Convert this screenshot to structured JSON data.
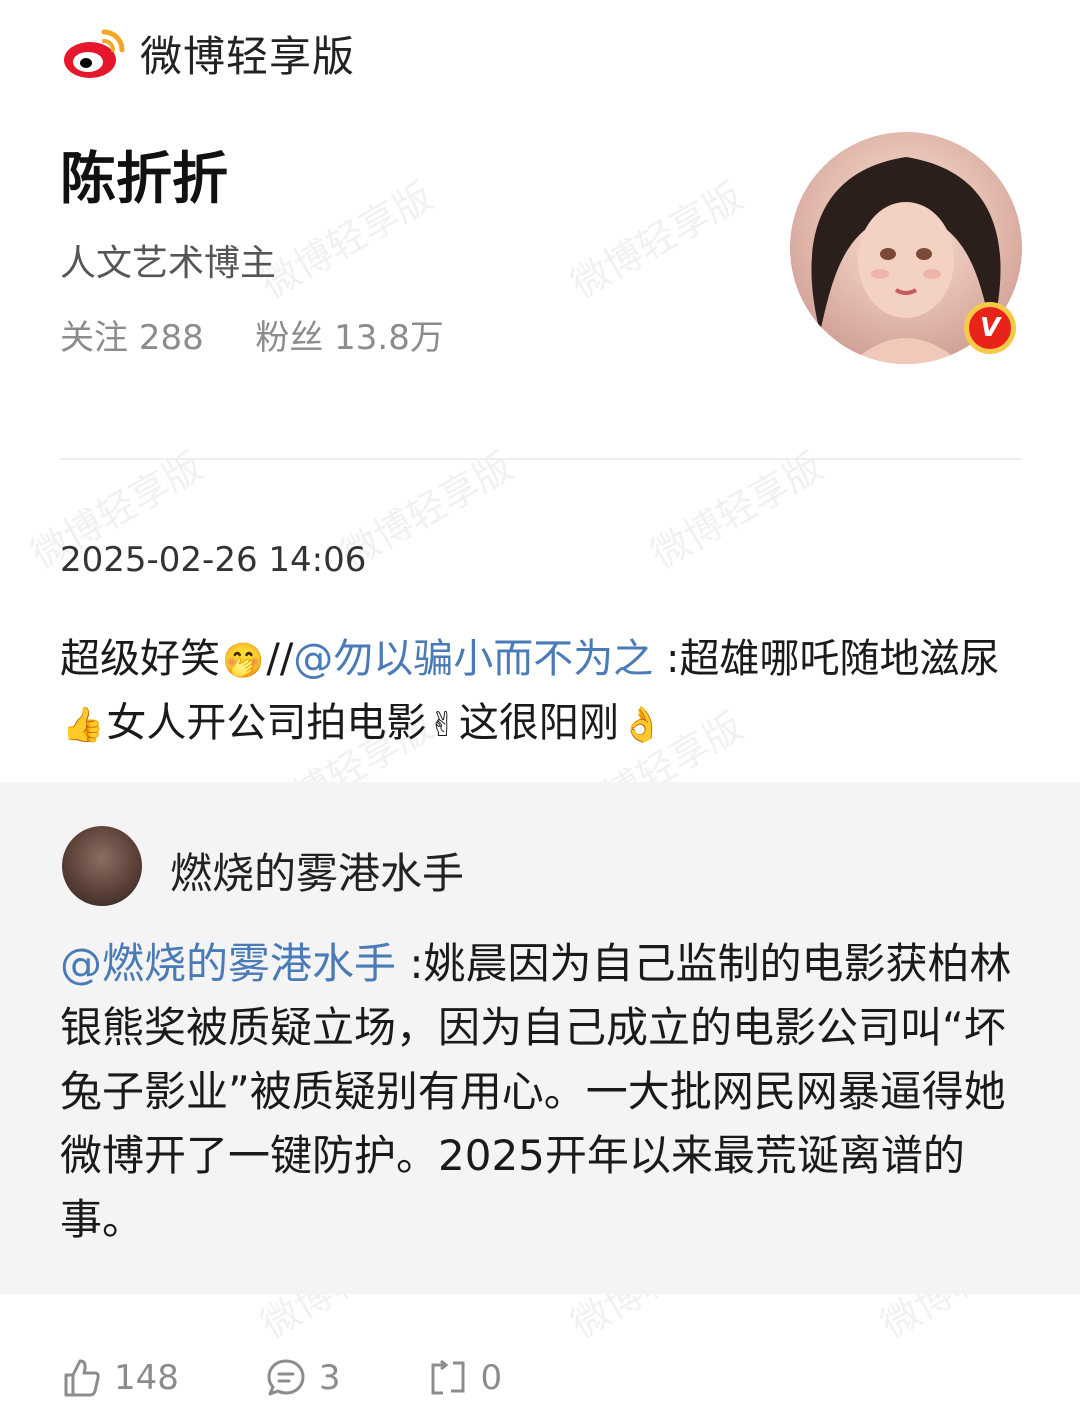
{
  "app": {
    "name": "微博轻享版",
    "logo_icon": "weibo-logo-icon",
    "watermark": "微博轻享版"
  },
  "profile": {
    "name": "陈折折",
    "description": "人文艺术博主",
    "stats": {
      "following_label": "关注",
      "following_count": "288",
      "followers_label": "粉丝",
      "followers_count": "13.8万"
    },
    "avatar_icon": "avatar-illustration",
    "verified_badge": "V"
  },
  "post": {
    "timestamp": "2025-02-26 14:06",
    "text": {
      "part1": "超级好笑",
      "emoji1": "🤭",
      "part2": "//",
      "mention": "@勿以骗小而不为之",
      "part3": " :超雄哪吒随地滋尿",
      "emoji2": "👍",
      "part4": "女人开公司拍电影",
      "emoji3": "✌",
      "part5": "这很阳刚",
      "emoji4": "👌"
    }
  },
  "repost": {
    "user": "燃烧的雾港水手",
    "mention": "@燃烧的雾港水手",
    "text": " :姚晨因为自己监制的电影获柏林银熊奖被质疑立场，因为自己成立的电影公司叫“坏兔子影业”被质疑别有用心。一大批网民网暴逼得她微博开了一键防护。2025开年以来最荒诞离谱的事。"
  },
  "actions": {
    "like_count": "148",
    "comment_count": "3",
    "repost_count": "0"
  },
  "colors": {
    "mention": "#4a7bb7",
    "brand_red": "#e8231a",
    "repost_bg": "#f4f4f4"
  }
}
